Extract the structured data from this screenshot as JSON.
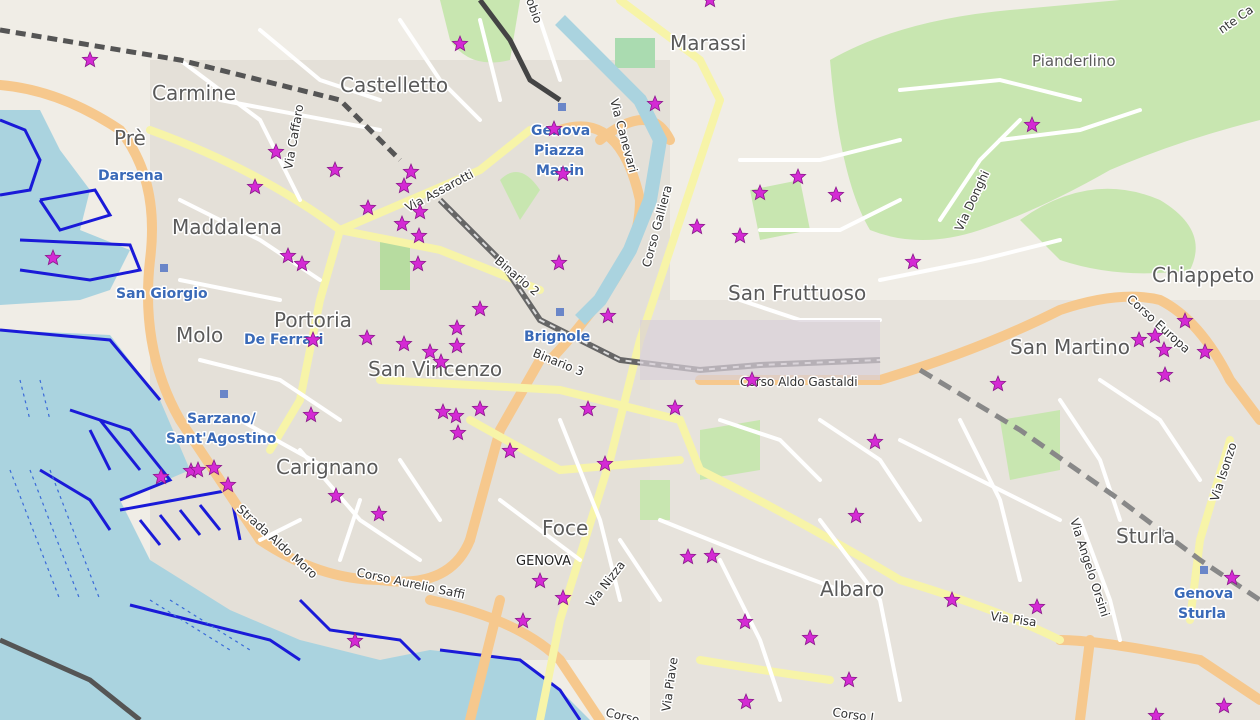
{
  "map": {
    "districts": {
      "marassi": "Marassi",
      "pianderlino": "Pianderlino",
      "carmine": "Carmine",
      "castelletto": "Castelletto",
      "pre": "Prè",
      "maddalena": "Maddalena",
      "chiappeto": "Chiappeto",
      "san_fruttuoso": "San Fruttuoso",
      "molo": "Molo",
      "portoria": "Portoria",
      "san_martino": "San Martino",
      "san_vincenzo": "San Vincenzo",
      "carignano": "Carignano",
      "sturla": "Sturla",
      "foce": "Foce",
      "genova": "GENOVA",
      "albaro": "Albaro"
    },
    "stations": {
      "darsena": "Darsena",
      "piazza_manin": [
        "Genova",
        "Piazza",
        "Manin"
      ],
      "san_giorgio": "San Giorgio",
      "brignole": "Brignole",
      "de_ferrari": "De Ferrari",
      "sarzano": [
        "Sarzano/",
        "Sant'Agostino"
      ],
      "genova_sturla": [
        "Genova",
        "Sturla"
      ]
    },
    "streets": {
      "via_caffaro": "Via Caffaro",
      "via_assarotti": "Via Assarotti",
      "via_canevari": "Via Canevari",
      "corso_galliera": "Corso Galliera",
      "via_donghi": "Via Donghi",
      "binario_2": "Binario 2",
      "binario_3": "Binario 3",
      "corso_aldo_gastaldi": "Corso Aldo Gastaldi",
      "corso_europa": "Corso Europa",
      "via_isonzo": "Via Isonzo",
      "strada_aldo_moro": "Strada Aldo Moro",
      "corso_aurelio_saffi": "Corso Aurelio Saffi",
      "via_nizza": "Via Nizza",
      "via_angelo_orsini": "Via Angelo Orsini",
      "via_pisa": "Via Pisa",
      "via_piave": "Via Piave",
      "corso_bottom": "Corso I",
      "corso_bottom2": "Corso",
      "top_right_fragment": "nte Ca",
      "top_fragment": "obio"
    },
    "marker_color": "#d42ad4",
    "water_color": "#aad3df",
    "harbor_line_color": "#1a1ad8",
    "park_color": "#c8e6b0"
  }
}
